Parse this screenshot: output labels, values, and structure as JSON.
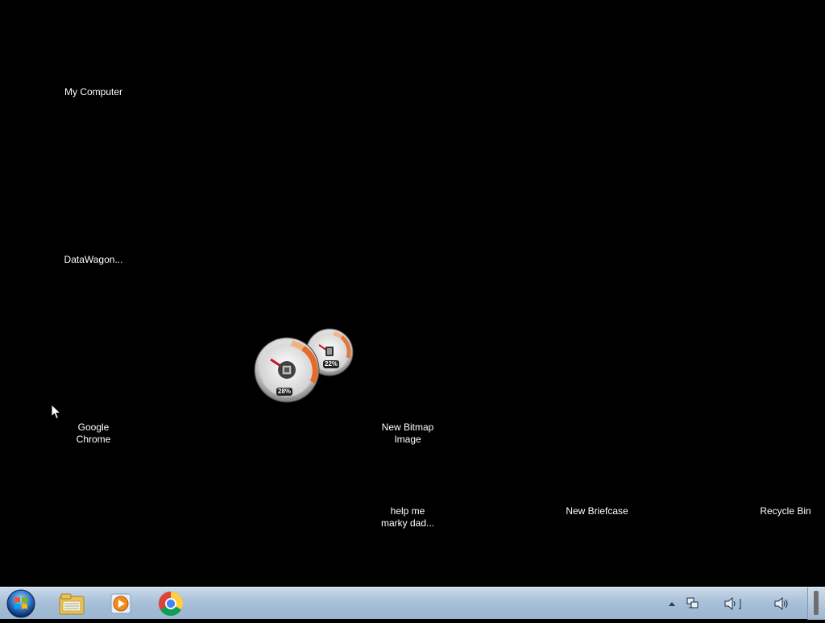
{
  "desktop": {
    "icons": [
      {
        "label": "My Computer"
      },
      {
        "label": "DataWagon..."
      },
      {
        "label_line1": "Google",
        "label_line2": "Chrome"
      },
      {
        "label_line1": "New Bitmap",
        "label_line2": "Image"
      },
      {
        "label_line1": "help me",
        "label_line2": "marky dad..."
      },
      {
        "label": "New Briefcase"
      },
      {
        "label": "Recycle Bin"
      }
    ],
    "gadget": {
      "cpu_percent": "28%",
      "memory_percent": "22%"
    }
  },
  "taskbar": {
    "start_icon": "windows-orb-icon",
    "pinned": [
      {
        "icon": "windows-explorer-icon"
      },
      {
        "icon": "media-player-icon"
      },
      {
        "icon": "google-chrome-icon"
      }
    ],
    "tray": [
      {
        "icon": "show-hidden-icons-arrow-icon"
      },
      {
        "icon": "network-icon"
      },
      {
        "icon": "volume-icon"
      },
      {
        "icon": "volume-icon"
      }
    ]
  },
  "colors": {
    "desktop_background": "#000000",
    "taskbar": "#a7bfd8"
  }
}
